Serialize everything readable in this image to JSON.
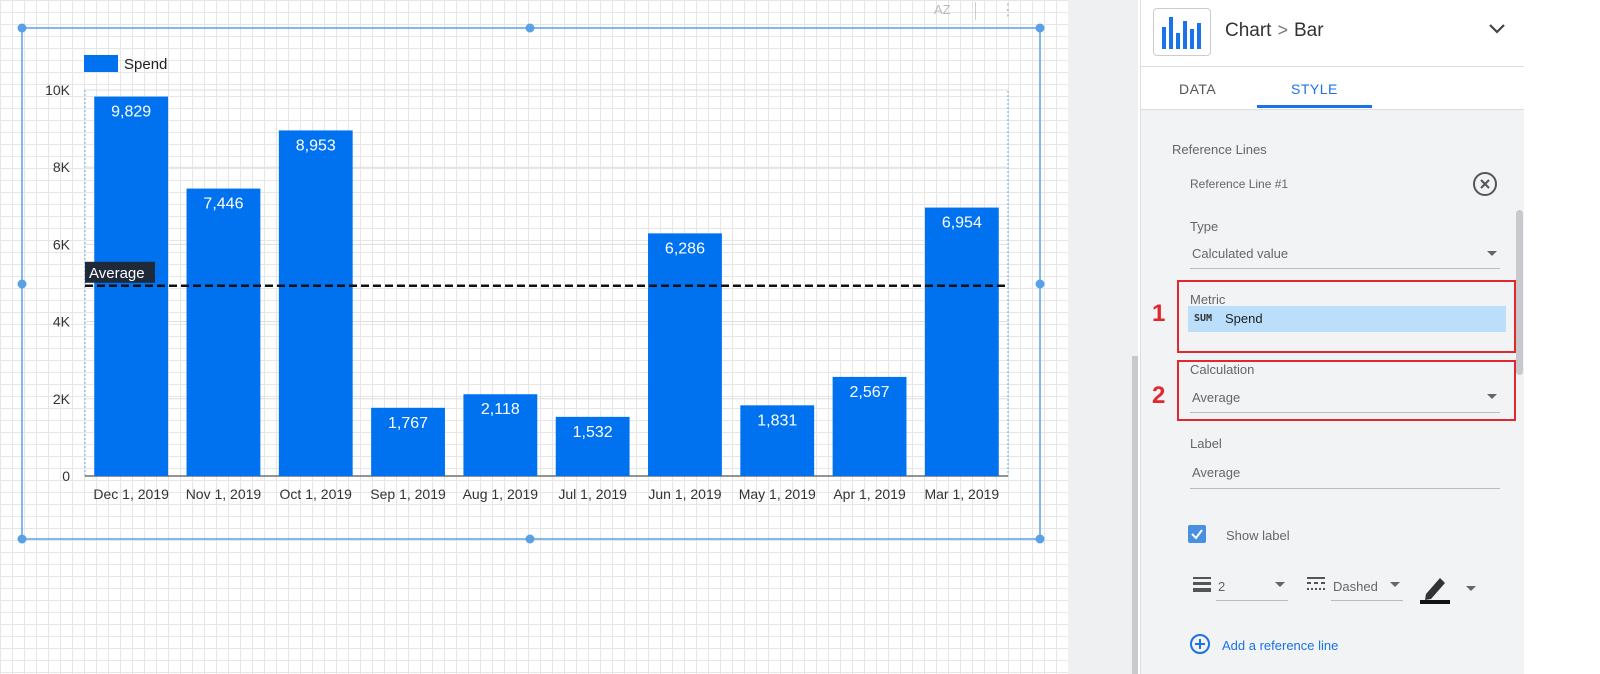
{
  "header": {
    "crumb_root": "Chart",
    "crumb_sep": ">",
    "crumb_leaf": "Bar"
  },
  "tabs": [
    {
      "label": "DATA"
    },
    {
      "label": "STYLE",
      "active": true
    }
  ],
  "toolbar": {
    "sort_icon": "AZ",
    "more_icon": "⋮"
  },
  "style_panel": {
    "section_title": "Reference Lines",
    "reference_line_title": "Reference Line #1",
    "type": {
      "label": "Type",
      "value": "Calculated value"
    },
    "metric": {
      "label": "Metric",
      "badge": "SUM",
      "value": "Spend"
    },
    "calculation": {
      "label": "Calculation",
      "value": "Average"
    },
    "label_field": {
      "label": "Label",
      "value": "Average"
    },
    "show_label": {
      "label": "Show label",
      "checked": true
    },
    "line_weight": "2",
    "line_style": "Dashed",
    "add_reference_line": "Add a reference line"
  },
  "annotations": [
    "1",
    "2"
  ],
  "icons": {
    "chart_type": "bar-chart-icon",
    "collapse": "chevron-down-icon",
    "remove": "close-circle-icon",
    "weight": "line-weight-icon",
    "style": "line-style-icon",
    "color": "pen-color-icon",
    "add": "add-circle-icon"
  },
  "colors": {
    "bar": "#0072f0",
    "accent": "#1a73e8",
    "annotation": "#e0282e"
  },
  "chart_data": {
    "type": "bar",
    "categories": [
      "Dec 1, 2019",
      "Nov 1, 2019",
      "Oct 1, 2019",
      "Sep 1, 2019",
      "Aug 1, 2019",
      "Jul 1, 2019",
      "Jun 1, 2019",
      "May 1, 2019",
      "Apr 1, 2019",
      "Mar 1, 2019"
    ],
    "series": [
      {
        "name": "Spend",
        "values": [
          9829,
          7446,
          8953,
          1767,
          2118,
          1532,
          6286,
          1831,
          2567,
          6954
        ]
      }
    ],
    "ylim": [
      0,
      10000
    ],
    "yticks": [
      0,
      2000,
      4000,
      6000,
      8000,
      10000
    ],
    "ytick_labels": [
      "0",
      "2K",
      "4K",
      "6K",
      "8K",
      "10K"
    ],
    "data_labels": [
      "9,829",
      "7,446",
      "8,953",
      "1,767",
      "2,118",
      "1,532",
      "6,286",
      "1,831",
      "2,567",
      "6,954"
    ],
    "reference_line": {
      "label": "Average",
      "value": 4928,
      "style": "dashed"
    },
    "legend": {
      "entries": [
        "Spend"
      ],
      "position": "top-left"
    },
    "grid": true
  }
}
